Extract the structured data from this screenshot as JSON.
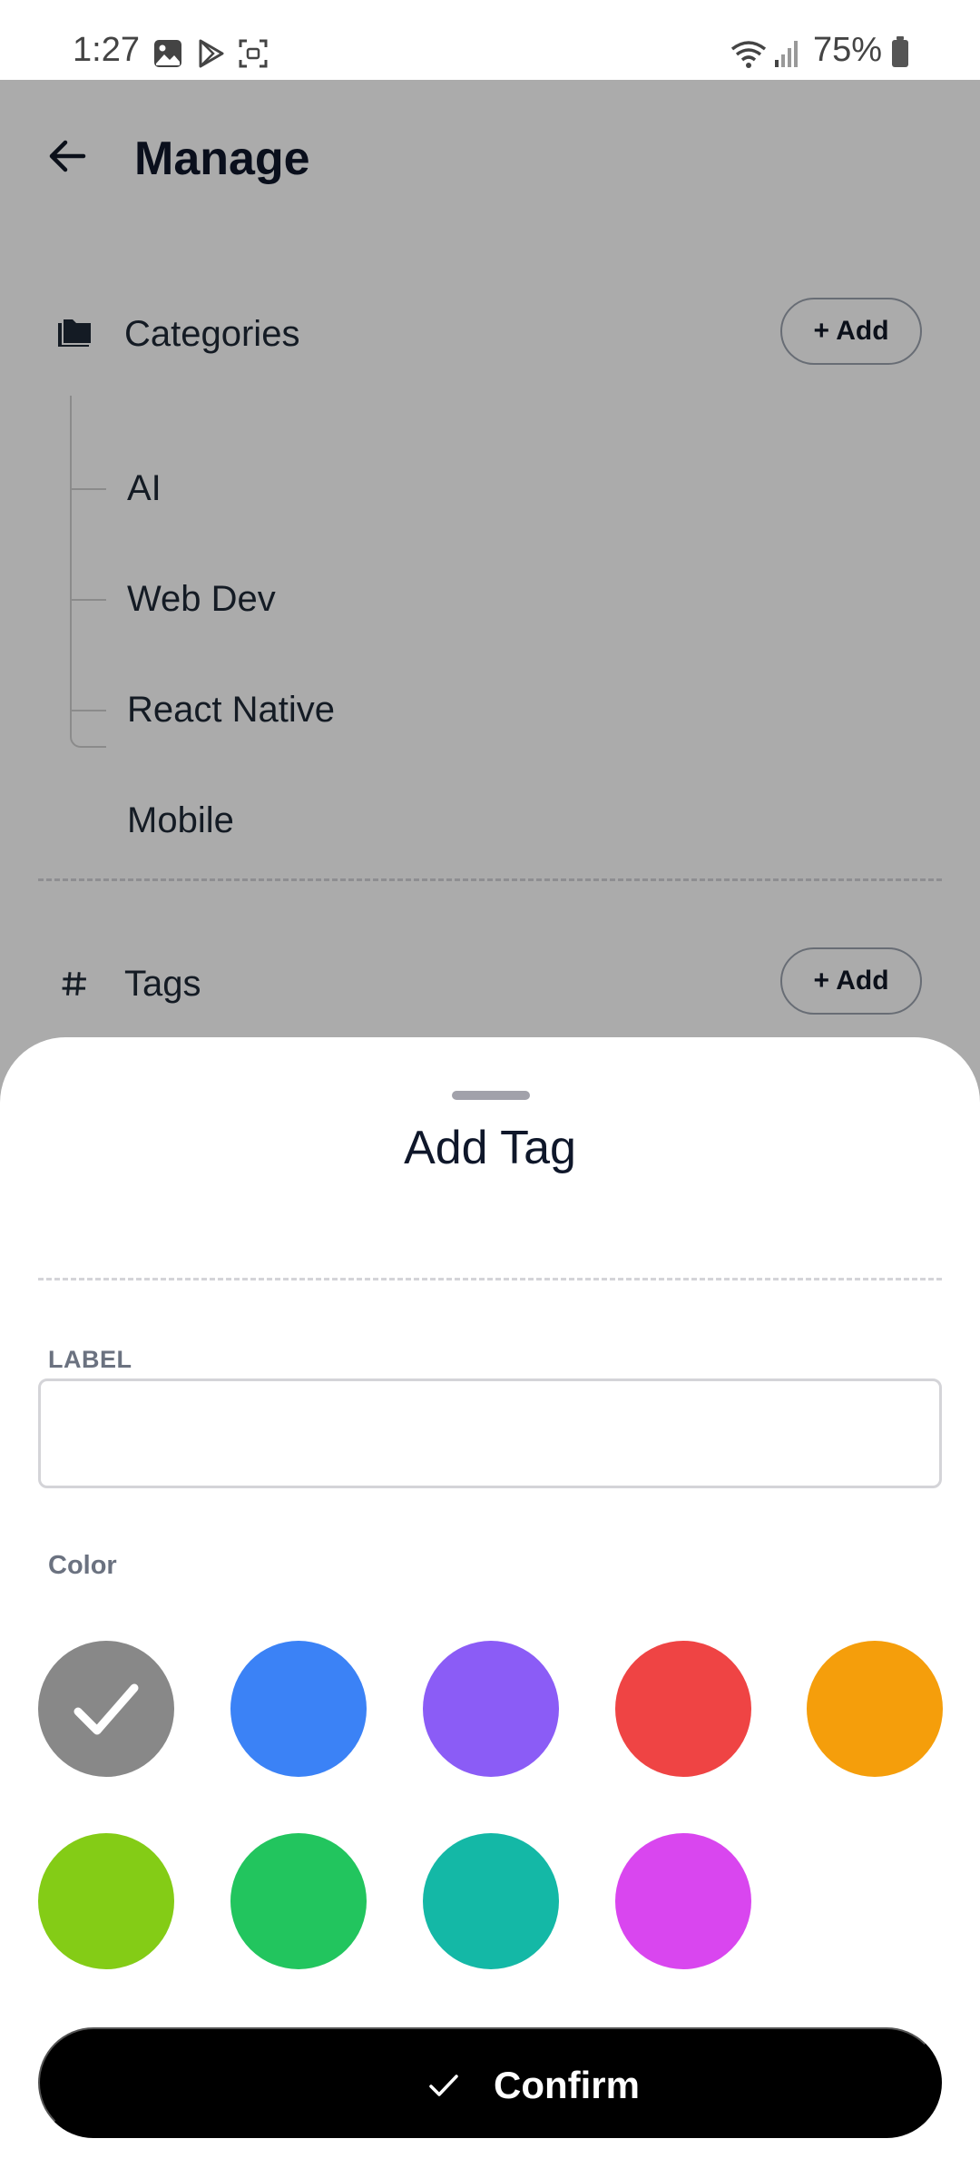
{
  "status_bar": {
    "time": "1:27",
    "battery": "75%"
  },
  "app": {
    "title": "Manage",
    "categories": {
      "title": "Categories",
      "add_label": "+ Add",
      "items": [
        {
          "label": "AI"
        },
        {
          "label": "Web Dev"
        },
        {
          "label": "React Native"
        },
        {
          "label": "Mobile"
        }
      ]
    },
    "tags": {
      "title": "Tags",
      "add_label": "+ Add"
    }
  },
  "sheet": {
    "title": "Add Tag",
    "label_field": {
      "label": "LABEL",
      "value": "",
      "placeholder": ""
    },
    "color_label": "Color",
    "colors": [
      {
        "name": "gray",
        "hex": "#888888",
        "selected": true
      },
      {
        "name": "blue",
        "hex": "#3b82f6",
        "selected": false
      },
      {
        "name": "purple",
        "hex": "#8b5cf6",
        "selected": false
      },
      {
        "name": "red",
        "hex": "#ef4444",
        "selected": false
      },
      {
        "name": "amber",
        "hex": "#f59e0b",
        "selected": false
      },
      {
        "name": "lime",
        "hex": "#84cc16",
        "selected": false
      },
      {
        "name": "green",
        "hex": "#22c55e",
        "selected": false
      },
      {
        "name": "teal",
        "hex": "#14b8a6",
        "selected": false
      },
      {
        "name": "fuchsia",
        "hex": "#d946ef",
        "selected": false
      }
    ],
    "confirm_label": "Confirm"
  }
}
